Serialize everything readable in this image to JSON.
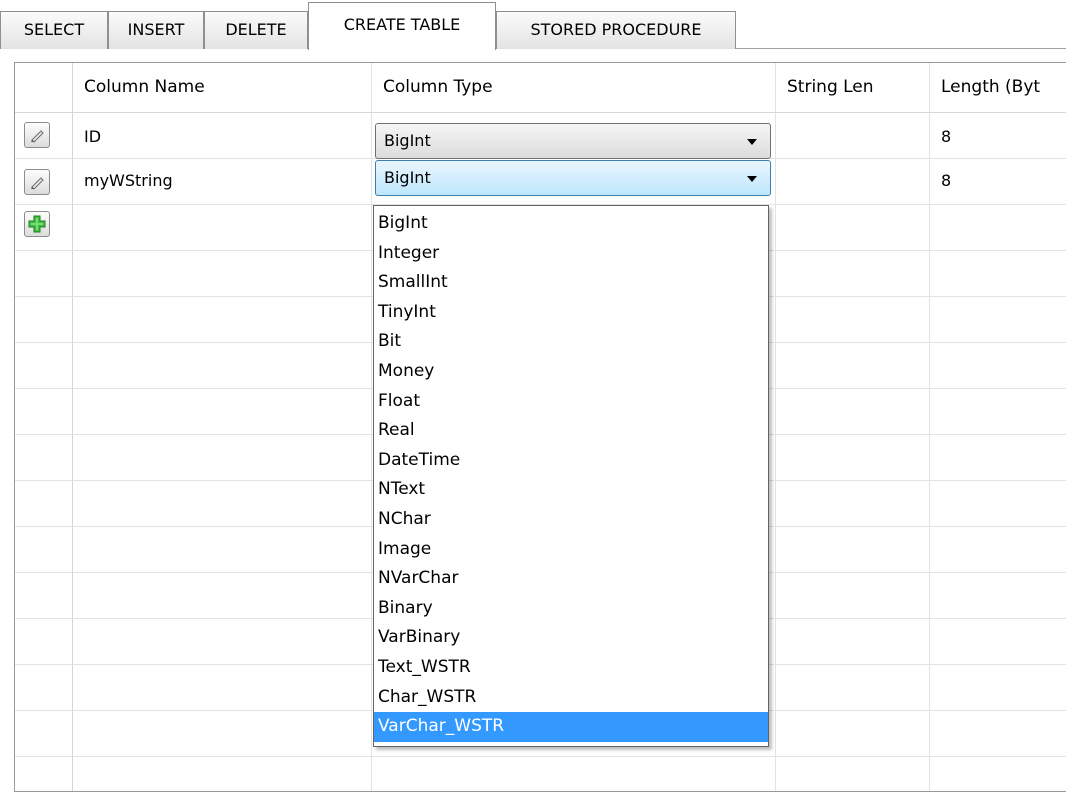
{
  "tabs": [
    {
      "label": "SELECT",
      "active": false
    },
    {
      "label": "INSERT",
      "active": false
    },
    {
      "label": "DELETE",
      "active": false
    },
    {
      "label": "CREATE TABLE",
      "active": true
    },
    {
      "label": "STORED PROCEDURE",
      "active": false
    }
  ],
  "grid": {
    "columns": [
      "Column Name",
      "Column Type",
      "String Len",
      "Length (Byt"
    ],
    "rows": [
      {
        "name": "ID",
        "type": "BigInt",
        "string_len": "",
        "length": "8",
        "row_icon": "pencil-icon"
      },
      {
        "name": "myWString",
        "type": "BigInt",
        "string_len": "",
        "length": "8",
        "row_icon": "pencil-icon"
      }
    ],
    "add_row_icon": "plus-icon"
  },
  "dropdown": {
    "items": [
      "BigInt",
      "Integer",
      "SmallInt",
      "TinyInt",
      "Bit",
      "Money",
      "Float",
      "Real",
      "DateTime",
      "NText",
      "NChar",
      "Image",
      "NVarChar",
      "Binary",
      "VarBinary",
      "Text_WSTR",
      "Char_WSTR",
      "VarChar_WSTR"
    ],
    "highlighted": "VarChar_WSTR"
  },
  "colors": {
    "selection": "#3399ff",
    "combo_open_border": "#3c7fb1",
    "add_icon": "#2fa52f"
  }
}
